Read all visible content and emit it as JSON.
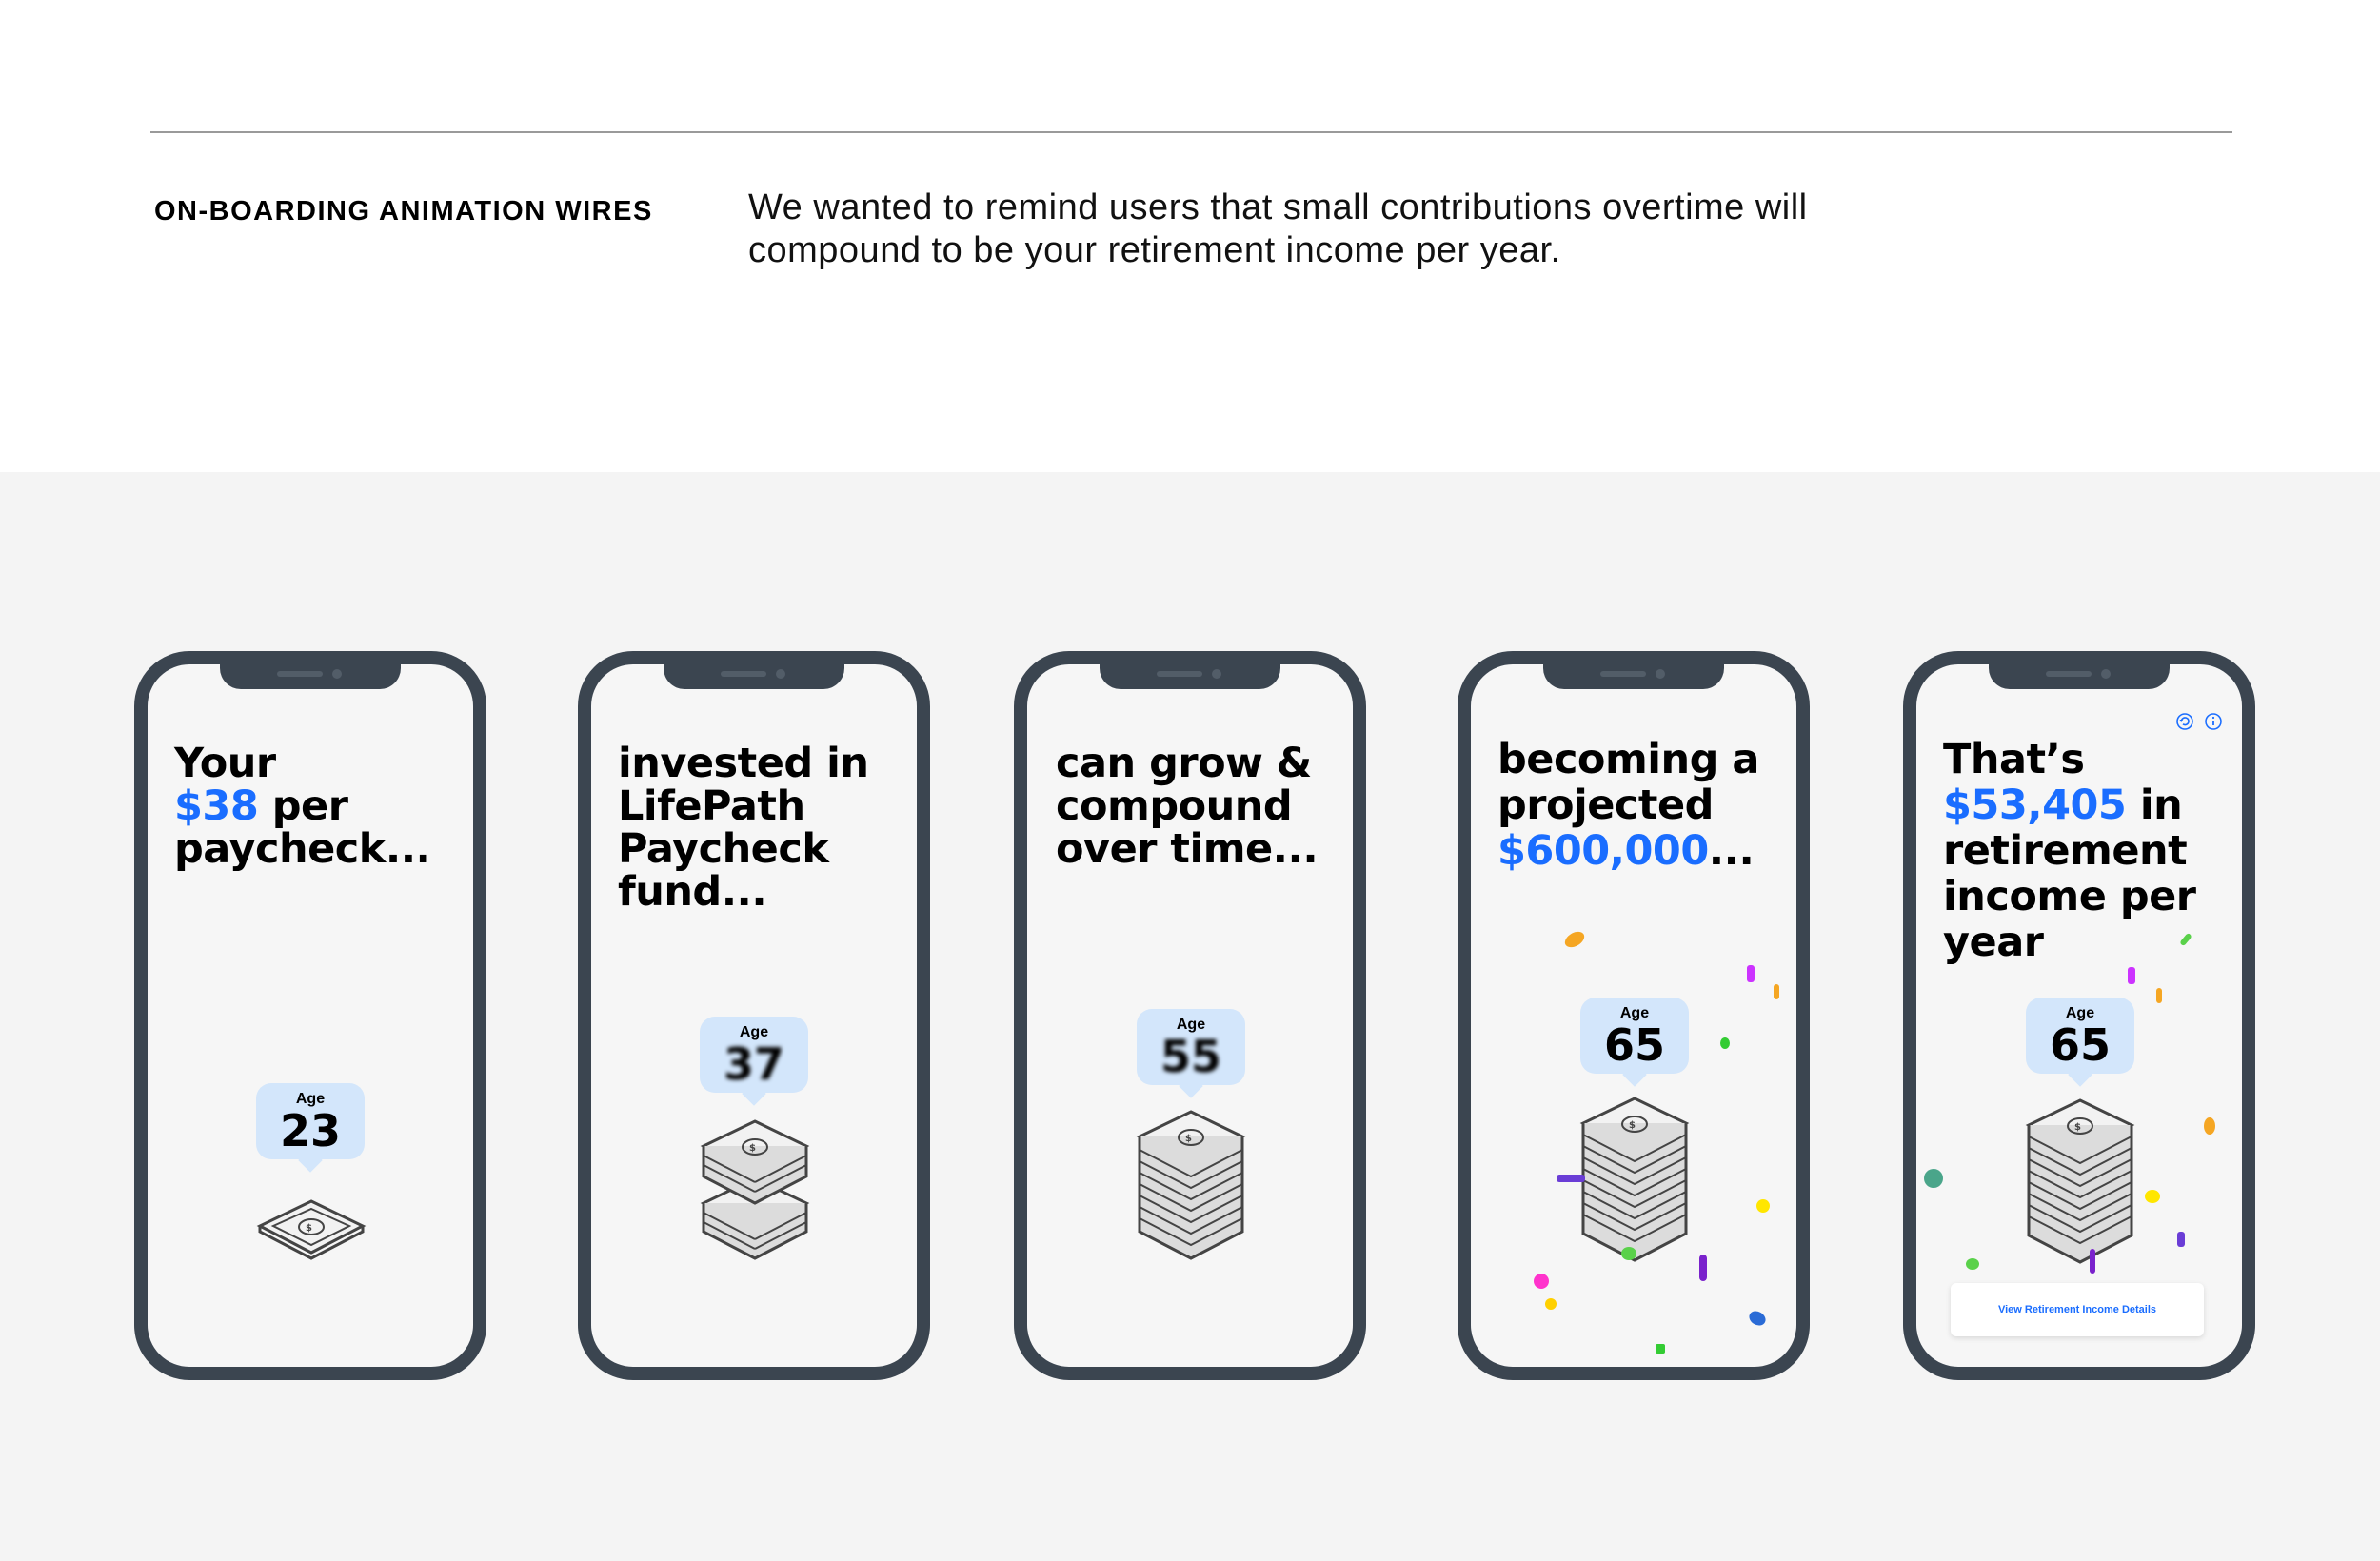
{
  "header": {
    "label": "ON-BOARDING ANIMATION WIRES",
    "description": "We wanted to remind users that small contributions overtime will compound to be your retirement income per year."
  },
  "screens": [
    {
      "line1": "Your",
      "amount": "$38",
      "rest": "per paycheck...",
      "age_label": "Age",
      "age": "23"
    },
    {
      "text": "invested in LifePath Paycheck fund...",
      "age_label": "Age",
      "age": "37"
    },
    {
      "text": "can grow & compound over time...",
      "age_label": "Age",
      "age": "55"
    },
    {
      "line1": "becoming a projected",
      "amount": "$600,000",
      "rest": "...",
      "age_label": "Age",
      "age": "65"
    },
    {
      "line1": "That’s",
      "amount": "$53,405",
      "rest": "in retirement income per year",
      "age_label": "Age",
      "age": "65",
      "button": "View Retirement Income Details",
      "icons": [
        "replay-icon",
        "info-icon"
      ]
    }
  ],
  "colors": {
    "accent": "#1a6dff",
    "phone_frame": "#3b4550",
    "bubble": "#d3e6fb",
    "gallery_bg": "#f4f4f4"
  }
}
